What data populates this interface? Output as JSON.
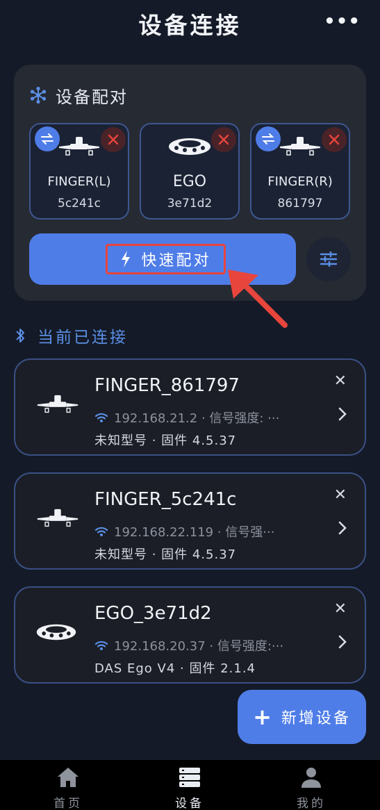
{
  "header": {
    "title": "设备连接",
    "more_label": "•••"
  },
  "pairing": {
    "title": "设备配对",
    "devices": [
      {
        "name": "FINGER(L)",
        "code": "5c241c"
      },
      {
        "name": "EGO",
        "code": "3e71d2"
      },
      {
        "name": "FINGER(R)",
        "code": "861797"
      }
    ],
    "quick_pair_label": "快速配对"
  },
  "connected": {
    "title": "当前已连接",
    "devices": [
      {
        "name": "FINGER_861797",
        "meta": "192.168.21.2 · 信号强度: ···",
        "firmware": "未知型号 · 固件 4.5.37"
      },
      {
        "name": "FINGER_5c241c",
        "meta": "192.168.22.119 · 信号强··· ",
        "firmware": "未知型号 · 固件 4.5.37"
      },
      {
        "name": "EGO_3e71d2",
        "meta": "192.168.20.37 · 信号强度:···",
        "firmware": "DAS Ego V4 · 固件 2.1.4"
      }
    ]
  },
  "fab": {
    "label": "新增设备"
  },
  "tabs": [
    {
      "label": "首页"
    },
    {
      "label": "设备"
    },
    {
      "label": "我的"
    }
  ],
  "colors": {
    "accent": "#4f7de8",
    "danger": "#e8453c",
    "background": "#141a27"
  }
}
